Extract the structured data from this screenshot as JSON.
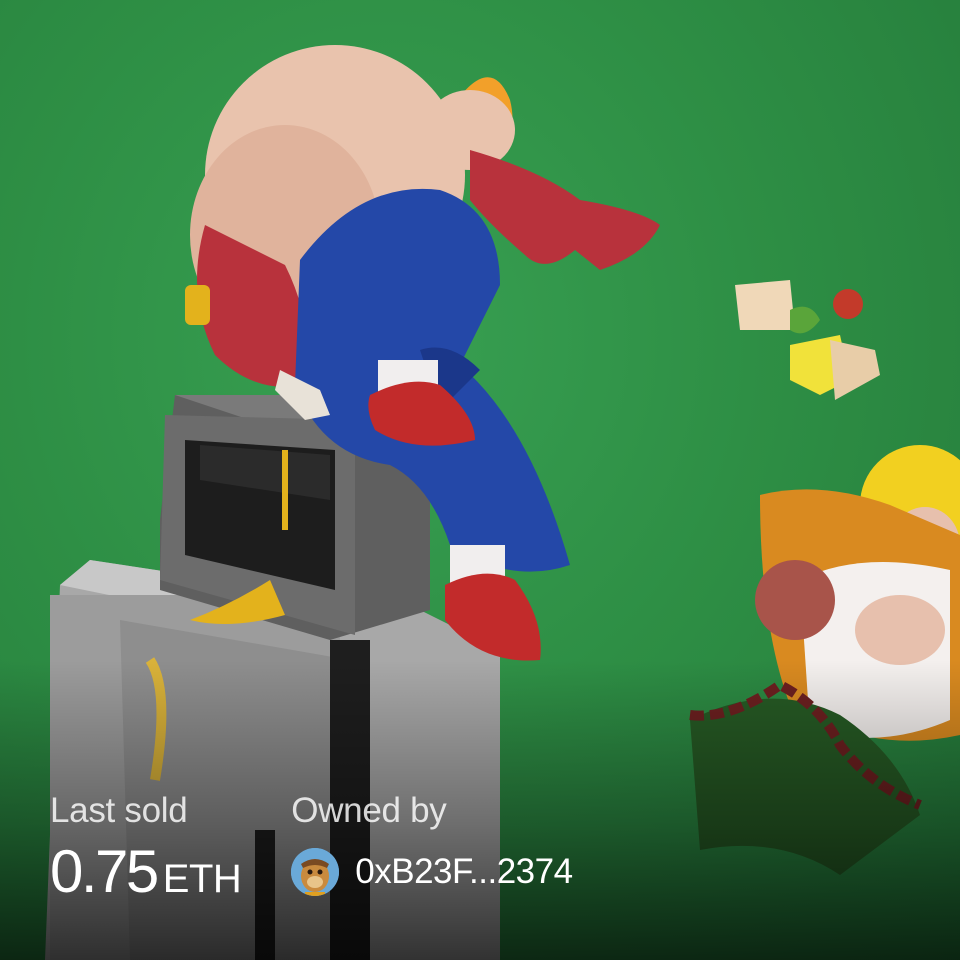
{
  "artwork": {
    "name": "nft-artwork",
    "colors": {
      "background": "#2e8f45",
      "skin": "#e9c3ad",
      "sleeve": "#b8323c",
      "hair": "#f2a02a",
      "pants": "#2448a8",
      "shoes": "#c22b2b",
      "appliance": "#a9a9a9",
      "mustard": "#e3b21c",
      "jacket": "#d98a20"
    }
  },
  "last_sold": {
    "label": "Last sold",
    "value": "0.75",
    "unit": "ETH"
  },
  "owner": {
    "label": "Owned by",
    "avatar_icon": "ape-avatar-icon",
    "address": "0xB23F...2374"
  }
}
